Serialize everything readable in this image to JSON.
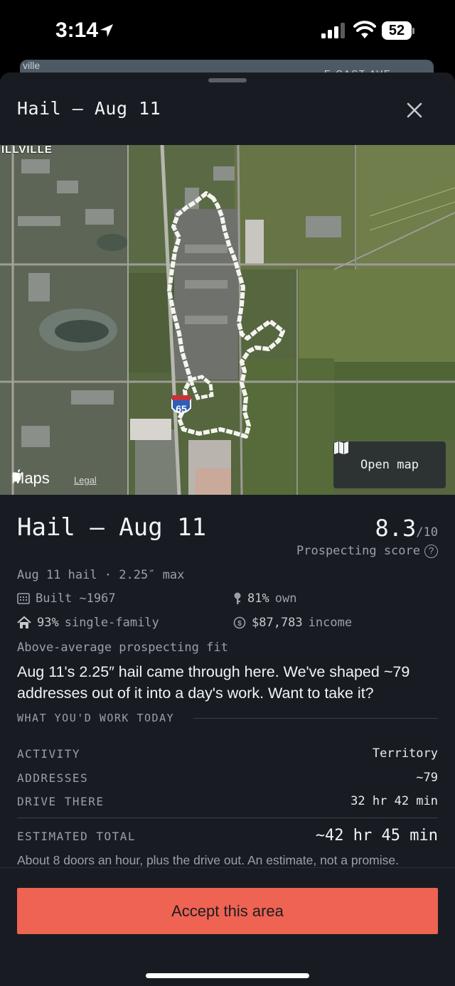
{
  "status_bar": {
    "time": "3:14",
    "battery": "52"
  },
  "underlying_sheet": {
    "left_text": "ville",
    "right_text": "E CAST AVE"
  },
  "sheet": {
    "title": "Hail — Aug 11"
  },
  "map": {
    "city_label": "ILLVILLE",
    "highway_shield": "65",
    "attribution": "Maps",
    "legal_label": "Legal",
    "open_map_label": "Open map"
  },
  "details": {
    "title": "Hail — Aug 11",
    "score_value": "8.3",
    "score_denominator": "/10",
    "score_label": "Prospecting score",
    "subline": "Aug 11 hail · 2.25″ max",
    "stats": {
      "built": "Built ~1967",
      "own_pct": "81%",
      "own_label": "own",
      "single_family_pct": "93%",
      "single_family_label": "single-family",
      "income_value": "$87,783",
      "income_label": "income"
    },
    "fit": "Above-average prospecting fit",
    "pitch": "Aug 11's 2.25″ hail came through here. We've shaped ~79 addresses out of it into a day's work. Want to take it?"
  },
  "work_today": {
    "heading": "WHAT YOU'D WORK TODAY",
    "rows": [
      {
        "label": "ACTIVITY",
        "value": "Territory"
      },
      {
        "label": "ADDRESSES",
        "value": "~79"
      },
      {
        "label": "DRIVE THERE",
        "value": "32 hr 42 min"
      }
    ],
    "total_label": "ESTIMATED TOTAL",
    "total_value": "~42 hr 45 min",
    "note": "About 8 doors an hour, plus the drive out. An estimate, not a promise."
  },
  "actions": {
    "accept_label": "Accept this area"
  },
  "colors": {
    "sheet_bg": "#181c22",
    "accent": "#ee6352",
    "muted_text": "#9aa0a6",
    "primary_text": "#f1f3f4"
  }
}
